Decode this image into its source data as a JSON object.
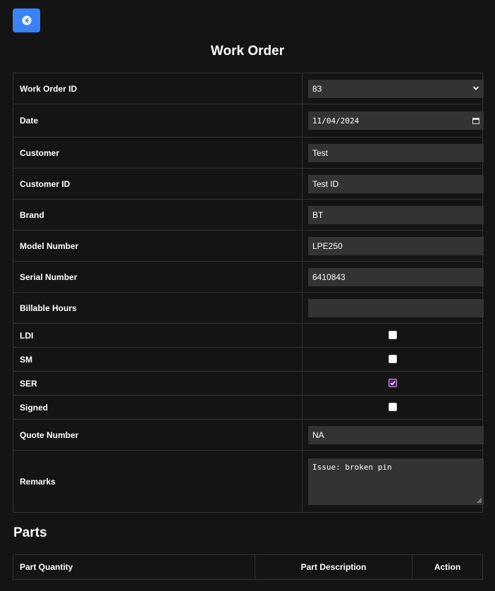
{
  "back_button": {
    "icon": "arrow-left-circle-icon"
  },
  "page_title": "Work Order",
  "form": {
    "work_order_id": {
      "label": "Work Order ID",
      "value": "83"
    },
    "date": {
      "label": "Date",
      "value": "11/04/2024"
    },
    "customer": {
      "label": "Customer",
      "value": "Test"
    },
    "customer_id": {
      "label": "Customer ID",
      "value": "Test ID"
    },
    "brand": {
      "label": "Brand",
      "value": "BT"
    },
    "model_number": {
      "label": "Model Number",
      "value": "LPE250"
    },
    "serial_number": {
      "label": "Serial Number",
      "value": "6410843"
    },
    "billable_hours": {
      "label": "Billable Hours",
      "value": ""
    },
    "ldi": {
      "label": "LDI",
      "checked": false
    },
    "sm": {
      "label": "SM",
      "checked": false
    },
    "ser": {
      "label": "SER",
      "checked": true
    },
    "signed": {
      "label": "Signed",
      "checked": false
    },
    "quote_number": {
      "label": "Quote Number",
      "value": "NA"
    },
    "remarks": {
      "label": "Remarks",
      "value": "Issue: broken pin"
    }
  },
  "parts": {
    "heading": "Parts",
    "columns": [
      "Part Quantity",
      "Part Description",
      "Action"
    ]
  },
  "colors": {
    "accent": "#3b82f6",
    "background": "#141414",
    "field": "#333333",
    "checked": "#5b1f74"
  }
}
